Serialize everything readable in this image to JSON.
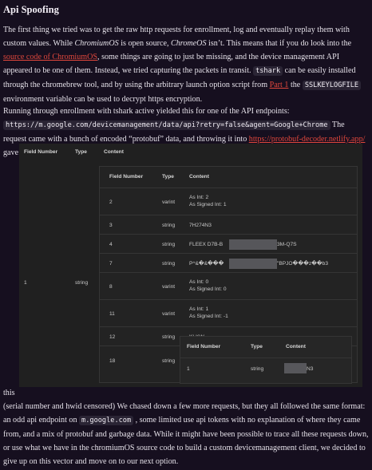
{
  "title": "Api Spoofing",
  "p1": {
    "t1": "The first thing we tried was to get the raw http requests for enrollment, log and eventually replay them with custom values. While ",
    "t2": "ChromiumOS",
    "t3": " is open source, ",
    "t4": "ChromeOS",
    "t5": " isn’t. This means that if you do look into the ",
    "link1": "source code of ChromiumOS",
    "t6": ", some things are going to just be missing, and the device management API appeared to be one of them. Instead, we tried capturing the packets in transit. ",
    "code1": "tshark",
    "t7": " can be easily installed through the chromebrew tool, and by using the arbitrary launch option script from ",
    "link2": "Part 1",
    "t8": " the ",
    "code2": "SSLKEYLOGFILE",
    "t9": " environment variable can be used to decrypt https encryption."
  },
  "p2": {
    "t1": "Running through enrollment with tshark active yielded this for one of the API endpoints:",
    "code1": "https://m.google.com/devicemanagement/data/api?retry=false&agent=Google+Chrome",
    "t2": " The request came with a bunch of encoded “protobuf” data, and throwing it into ",
    "link1": "https://protobuf-decoder.netlify.app/",
    "t3": " gave"
  },
  "screenshot": {
    "headers": [
      "Field Number",
      "Type",
      "Content"
    ],
    "outer_row": {
      "field": "1",
      "type": "string"
    },
    "inner_headers": [
      "Field Number",
      "Type",
      "Content"
    ],
    "rows": [
      {
        "field": "2",
        "type": "varint",
        "content": [
          "As Int: 2",
          "As Signed Int: 1"
        ]
      },
      {
        "field": "3",
        "type": "string",
        "content": [
          "7H274N3"
        ]
      },
      {
        "field": "4",
        "type": "string",
        "content": [
          "FLEEX D7B-B",
          "3M-Q7S"
        ]
      },
      {
        "field": "7",
        "type": "string",
        "content": [
          "P^&�&���",
          "\"BPJO���z��b3"
        ]
      },
      {
        "field": "8",
        "type": "varint",
        "content": [
          "As Int: 0",
          "As Signed Int: 0"
        ]
      },
      {
        "field": "11",
        "type": "varint",
        "content": [
          "As Int: 1",
          "As Signed Int: -1"
        ]
      },
      {
        "field": "12",
        "type": "string",
        "content": [
          "KLKW"
        ]
      },
      {
        "field": "18",
        "type": "string",
        "content": []
      }
    ],
    "nested_headers": [
      "Field Number",
      "Type",
      "Content"
    ],
    "nested_row": {
      "field": "1",
      "type": "string",
      "content": "N3"
    }
  },
  "after_image": "this",
  "p3": {
    "t1": "(serial number and hwid censored) We chased down a few more requests, but they all followed the same format: an odd api endpoint on ",
    "code1": "m.google.com",
    "t2": " , some limited use api tokens with no explanation of where they came from, and a mix of protobuf and garbage data. While it might have been possible to trace all these requests down, or use what we have in the chromiumOS source code to build a custom devicemanagement client, we decided to give up on this vector and move on to our next option."
  }
}
